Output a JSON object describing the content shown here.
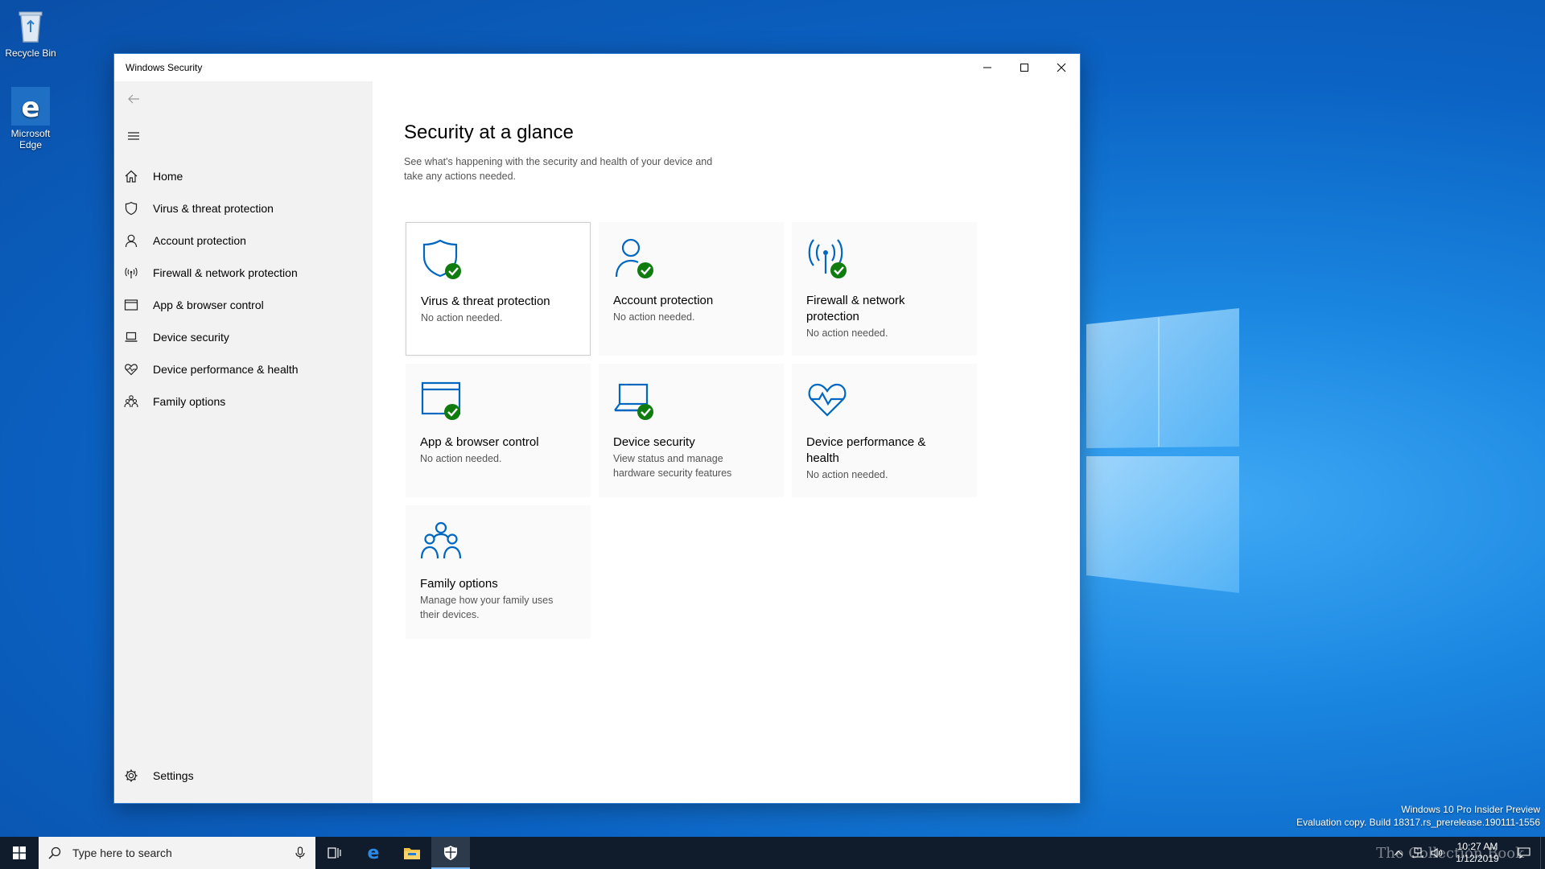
{
  "desktop": {
    "icons": [
      {
        "label": "Recycle Bin",
        "icon": "recycle-bin-icon"
      },
      {
        "label": "Microsoft Edge",
        "icon": "edge-icon"
      }
    ],
    "watermark": {
      "line1": "Windows 10 Pro Insider Preview",
      "line2": "Evaluation copy. Build 18317.rs_prerelease.190111-1556"
    },
    "brand_watermark": "The Collection Book"
  },
  "window": {
    "title": "Windows Security",
    "controls": {
      "minimize": "minimize-icon",
      "maximize": "maximize-icon",
      "close": "close-icon"
    }
  },
  "sidebar": {
    "items": [
      {
        "label": "Home",
        "icon": "home-icon"
      },
      {
        "label": "Virus & threat protection",
        "icon": "shield-icon"
      },
      {
        "label": "Account protection",
        "icon": "person-icon"
      },
      {
        "label": "Firewall & network protection",
        "icon": "antenna-icon"
      },
      {
        "label": "App & browser control",
        "icon": "browser-window-icon"
      },
      {
        "label": "Device security",
        "icon": "laptop-icon"
      },
      {
        "label": "Device performance & health",
        "icon": "heart-icon"
      },
      {
        "label": "Family options",
        "icon": "family-icon"
      }
    ],
    "settings_label": "Settings"
  },
  "main": {
    "title": "Security at a glance",
    "subtitle": "See what's happening with the security and health of your device and take any actions needed.",
    "tiles": [
      {
        "title": "Virus & threat protection",
        "status": "No action needed.",
        "icon": "shield-check-icon"
      },
      {
        "title": "Account protection",
        "status": "No action needed.",
        "icon": "person-check-icon"
      },
      {
        "title": "Firewall & network protection",
        "status": "No action needed.",
        "icon": "antenna-check-icon"
      },
      {
        "title": "App & browser control",
        "status": "No action needed.",
        "icon": "browser-check-icon"
      },
      {
        "title": "Device security",
        "status": "View status and manage hardware security features",
        "icon": "laptop-check-icon"
      },
      {
        "title": "Device performance & health",
        "status": "No action needed.",
        "icon": "heart-pulse-icon"
      },
      {
        "title": "Family options",
        "status": "Manage how your family uses their devices.",
        "icon": "family-icon"
      }
    ]
  },
  "taskbar": {
    "search_placeholder": "Type here to search",
    "apps": [
      "task-view-icon",
      "edge-icon",
      "file-explorer-icon",
      "windows-security-icon"
    ],
    "clock": {
      "time": "10:27 AM",
      "date": "1/12/2019"
    }
  },
  "colors": {
    "accent": "#0067c0",
    "check": "#107c10"
  }
}
